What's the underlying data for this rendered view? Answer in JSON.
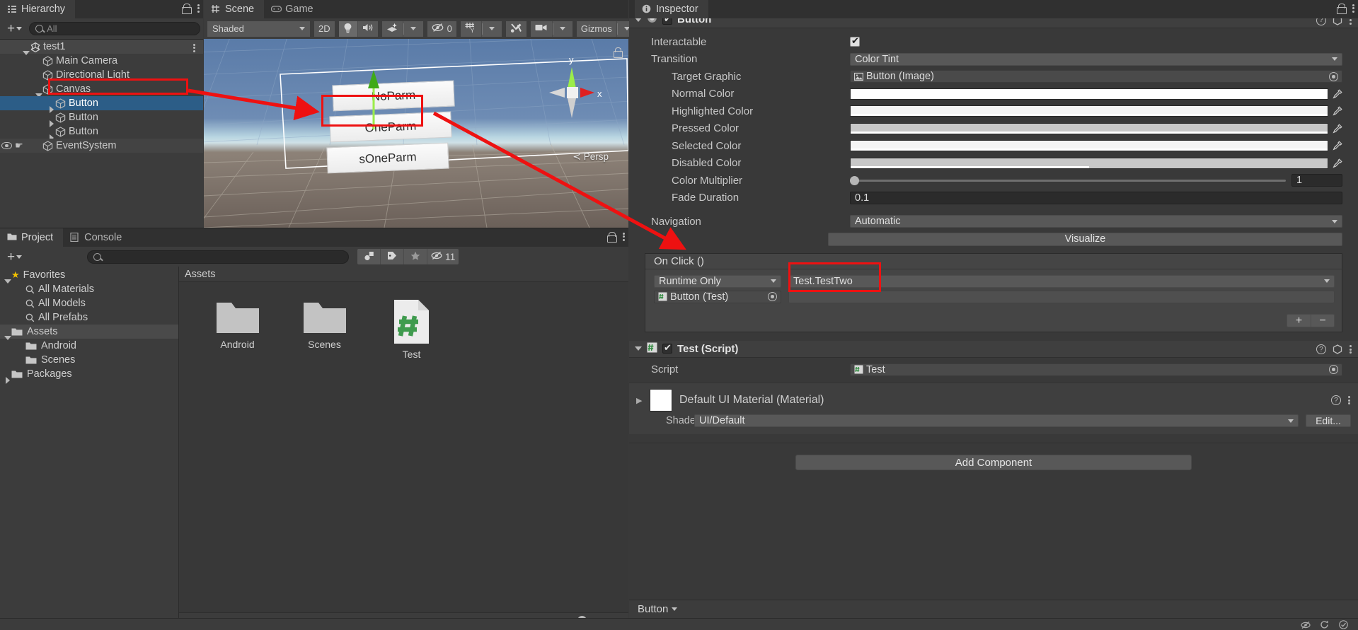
{
  "hierarchy": {
    "tab": "Hierarchy",
    "search_placeholder": "All",
    "create_label": "+",
    "items": [
      {
        "label": "test1",
        "depth": 0,
        "icon": "unity-logo",
        "disclosure": "open",
        "selected": false,
        "root": true
      },
      {
        "label": "Main Camera",
        "depth": 1,
        "icon": "cube-icon",
        "disclosure": "none",
        "selected": false,
        "root": false
      },
      {
        "label": "Directional Light",
        "depth": 1,
        "icon": "cube-icon",
        "disclosure": "none",
        "selected": false,
        "root": false
      },
      {
        "label": "Canvas",
        "depth": 1,
        "icon": "cube-icon",
        "disclosure": "open",
        "selected": false,
        "root": false
      },
      {
        "label": "Button",
        "depth": 2,
        "icon": "cube-icon",
        "disclosure": "closed",
        "selected": true,
        "root": false
      },
      {
        "label": "Button",
        "depth": 2,
        "icon": "cube-icon",
        "disclosure": "closed",
        "selected": false,
        "root": false
      },
      {
        "label": "Button",
        "depth": 2,
        "icon": "cube-icon",
        "disclosure": "closed",
        "selected": false,
        "root": false
      },
      {
        "label": "EventSystem",
        "depth": 1,
        "icon": "cube-icon",
        "disclosure": "none",
        "selected": false,
        "root": false
      }
    ]
  },
  "scene": {
    "tabs": [
      {
        "label": "Scene",
        "icon": "scene-icon",
        "active": true
      },
      {
        "label": "Game",
        "icon": "game-icon",
        "active": false
      }
    ],
    "toolbar": {
      "draw_mode": "Shaded",
      "view_2d": "2D",
      "lighting_icon": "lightbulb-icon",
      "audio_icon": "speaker-icon",
      "fx_icon": "effects-icon",
      "hidden_count": "0",
      "grid_icon": "grid-icon",
      "tools_icon": "tools-icon",
      "camera_icon": "camera-icon",
      "gizmos_label": "Gizmos"
    },
    "ui_buttons": [
      {
        "label": "NoParm"
      },
      {
        "label": "OneParm"
      },
      {
        "label": "sOneParm"
      }
    ],
    "gizmo": {
      "x_axis": "x",
      "y_axis": "y",
      "projection": "Persp"
    }
  },
  "project": {
    "tabs": [
      {
        "label": "Project",
        "icon": "folder-icon",
        "active": true
      },
      {
        "label": "Console",
        "icon": "console-icon",
        "active": false
      }
    ],
    "create_label": "+",
    "search_placeholder": "",
    "hidden_count": "11",
    "tree": [
      {
        "label": "Favorites",
        "depth": 0,
        "icon": "star-icon",
        "disclosure": "open",
        "selected": false
      },
      {
        "label": "All Materials",
        "depth": 1,
        "icon": "search-icon",
        "disclosure": "none",
        "selected": false
      },
      {
        "label": "All Models",
        "depth": 1,
        "icon": "search-icon",
        "disclosure": "none",
        "selected": false
      },
      {
        "label": "All Prefabs",
        "depth": 1,
        "icon": "search-icon",
        "disclosure": "none",
        "selected": false
      },
      {
        "label": "Assets",
        "depth": 0,
        "icon": "folder-icon",
        "disclosure": "open",
        "selected": true
      },
      {
        "label": "Android",
        "depth": 1,
        "icon": "folder-icon",
        "disclosure": "none",
        "selected": false
      },
      {
        "label": "Scenes",
        "depth": 1,
        "icon": "folder-icon",
        "disclosure": "none",
        "selected": false
      },
      {
        "label": "Packages",
        "depth": 0,
        "icon": "folder-icon",
        "disclosure": "closed",
        "selected": false
      }
    ],
    "breadcrumb": "Assets",
    "assets": [
      {
        "label": "Android",
        "type": "folder"
      },
      {
        "label": "Scenes",
        "type": "folder"
      },
      {
        "label": "Test",
        "type": "csharp-script"
      }
    ]
  },
  "inspector": {
    "tab": "Inspector",
    "button_component": {
      "title": "Button",
      "enabled": true,
      "rows": [
        {
          "label": "Interactable",
          "type": "checkbox",
          "value": true,
          "indent": false
        },
        {
          "label": "Transition",
          "type": "dropdown",
          "value": "Color Tint",
          "indent": false
        },
        {
          "label": "Target Graphic",
          "type": "object",
          "value": "Button (Image)",
          "indent": true
        },
        {
          "label": "Normal Color",
          "type": "color",
          "value": "#ffffff",
          "alpha": 100,
          "indent": true
        },
        {
          "label": "Highlighted Color",
          "type": "color",
          "value": "#f5f5f5",
          "alpha": 100,
          "indent": true
        },
        {
          "label": "Pressed Color",
          "type": "color",
          "value": "#c8c8c8",
          "alpha": 100,
          "indent": true
        },
        {
          "label": "Selected Color",
          "type": "color",
          "value": "#f5f5f5",
          "alpha": 100,
          "indent": true
        },
        {
          "label": "Disabled Color",
          "type": "color",
          "value": "#c8c8c8",
          "alpha": 50,
          "indent": true
        },
        {
          "label": "Color Multiplier",
          "type": "slider",
          "value": "1",
          "fill": 0,
          "indent": true
        },
        {
          "label": "Fade Duration",
          "type": "number",
          "value": "0.1",
          "indent": true
        },
        {
          "label": "Navigation",
          "type": "dropdown",
          "value": "Automatic",
          "indent": false
        }
      ],
      "visualize_label": "Visualize"
    },
    "on_click": {
      "title": "On Click ()",
      "entry": {
        "mode": "Runtime Only",
        "function": "Test.TestTwo",
        "object": "Button (Test)"
      },
      "add_label": "+",
      "remove_label": "−"
    },
    "test_script": {
      "title": "Test (Script)",
      "enabled": true,
      "script_label": "Script",
      "script_value": "Test"
    },
    "material": {
      "name": "Default UI Material (Material)",
      "shader_label": "Shader",
      "shader_value": "UI/Default",
      "edit_label": "Edit..."
    },
    "add_component": "Add Component",
    "footer_label": "Button"
  },
  "colors": {
    "selection_blue": "#2c5d87",
    "annotation_red": "#ee1111",
    "panel_bg": "#3c3c3c",
    "inspector_bg": "#393939",
    "script_green": "#3f9b4e",
    "gizmo_x": "#e02020",
    "gizmo_y": "#7ddc2a",
    "favorites_star": "#f2c100"
  }
}
